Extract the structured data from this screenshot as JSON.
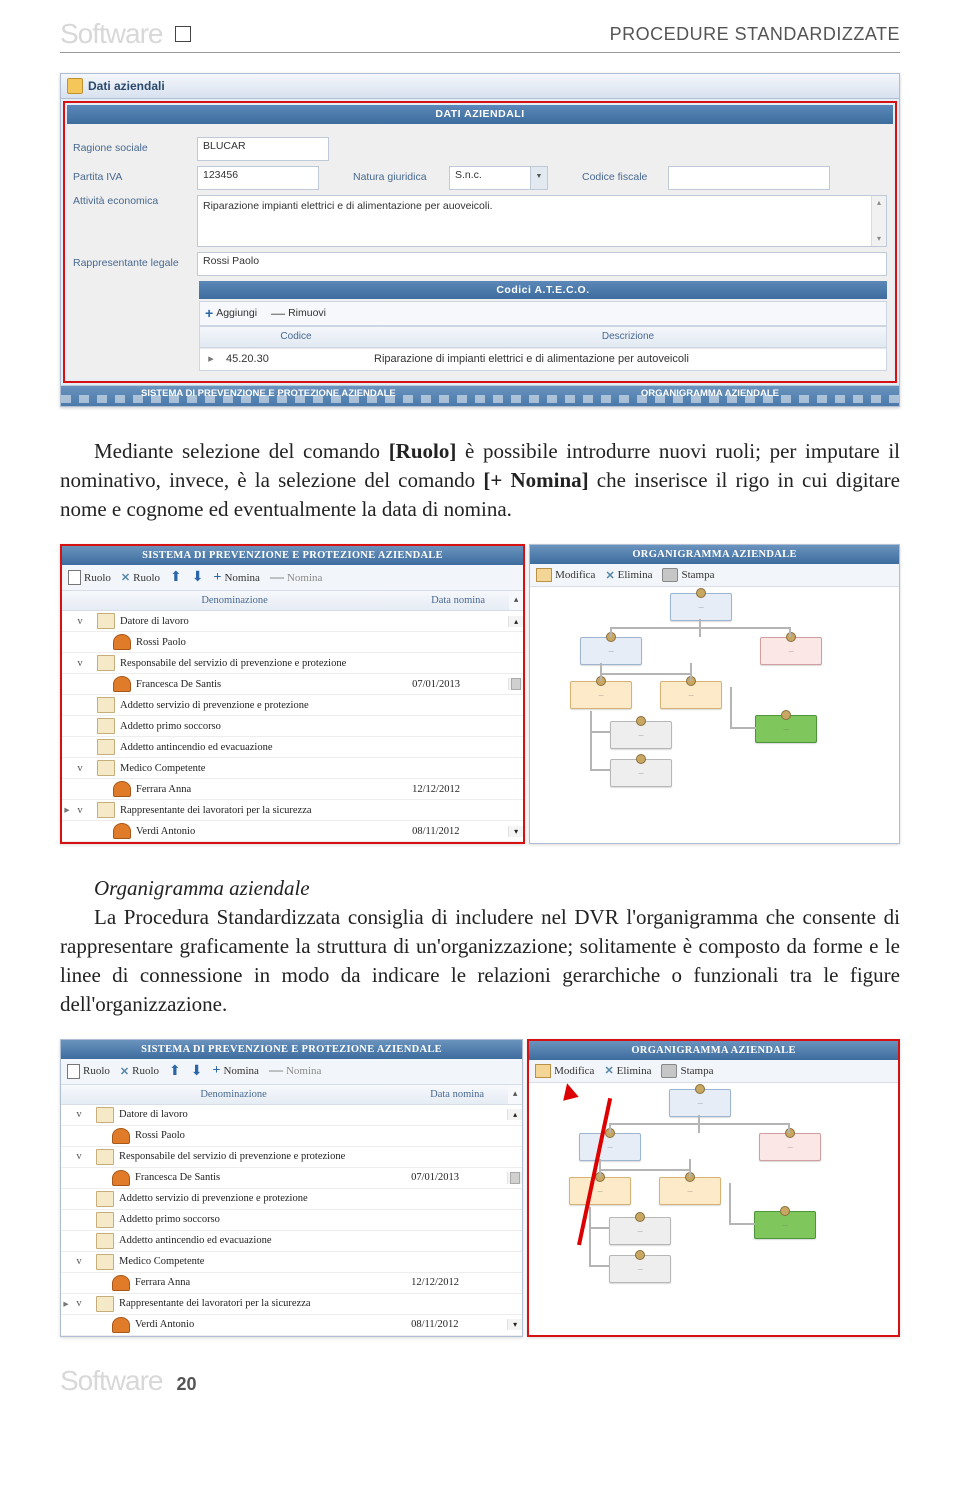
{
  "header": {
    "brand_a": "Software",
    "title": "PROCEDURE STANDARDIZZATE"
  },
  "paragraph1": {
    "line1": "Mediante selezione del comando ",
    "b1": "[Ruolo]",
    "line2": " è possibile introdurre nuovi ruoli; per imputare il nominativo, invece, è la selezione del comando ",
    "b2": "[+ Nomina]",
    "line3": " che inserisce il rigo in cui digitare nome e cognome ed eventualmente la data di nomina."
  },
  "section2": {
    "heading": "Organigramma aziendale",
    "text": "La Procedura Standardizzata consiglia di includere nel DVR l'organigramma che consente di rappresentare graficamente la struttura di un'organizzazione; solitamente è composto da forme e le linee di connessione in modo da indicare le relazioni gerarchiche o funzionali tra le figure dell'organizzazione."
  },
  "shot1": {
    "window_title": "Dati aziendali",
    "panel_title": "DATI AZIENDALI",
    "labels": {
      "ragione": "Ragione sociale",
      "piva": "Partita IVA",
      "natura": "Natura giuridica",
      "cf": "Codice fiscale",
      "attivita": "Attività economica",
      "rappr": "Rappresentante legale",
      "ateco_title": "Codici A.T.E.C.O.",
      "col_codice": "Codice",
      "col_descr": "Descrizione"
    },
    "values": {
      "ragione": "BLUCAR",
      "piva": "123456",
      "natura": "S.n.c.",
      "cf": "",
      "attivita": "Riparazione impianti elettrici e di alimentazione per auoveicoli.",
      "rappr": "Rossi Paolo",
      "codice": "45.20.30",
      "descr": "Riparazione di impianti elettrici e di alimentazione per autoveicoli",
      "add": "Aggiungi",
      "rem": "Rimuovi"
    },
    "strip_left": "SISTEMA DI PREVENZIONE E PROTEZIONE AZIENDALE",
    "strip_right": "ORGANIGRAMMA AZIENDALE"
  },
  "shot2": {
    "left_title": "SISTEMA DI PREVENZIONE E PROTEZIONE AZIENDALE",
    "right_title": "ORGANIGRAMMA AZIENDALE",
    "toolbar_left": {
      "ruolo": "Ruolo",
      "ruolo2": "Ruolo",
      "nomina": "Nomina",
      "nominag": "Nomina"
    },
    "toolbar_right": {
      "modifica": "Modifica",
      "elimina": "Elimina",
      "stampa": "Stampa"
    },
    "cols": {
      "c1": "Denominazione",
      "c2": "Data nomina"
    },
    "rows": [
      {
        "exp": "v",
        "type": "card",
        "label": "Datore di lavoro",
        "date": "",
        "indent": 0
      },
      {
        "exp": "",
        "type": "person",
        "label": "Rossi Paolo",
        "date": "",
        "indent": 1
      },
      {
        "exp": "v",
        "type": "card",
        "label": "Responsabile del servizio di prevenzione e protezione",
        "date": "",
        "indent": 0
      },
      {
        "exp": "",
        "type": "person",
        "label": "Francesca De Santis",
        "date": "07/01/2013",
        "indent": 1
      },
      {
        "exp": "",
        "type": "card",
        "label": "Addetto servizio di prevenzione e protezione",
        "date": "",
        "indent": 0
      },
      {
        "exp": "",
        "type": "card",
        "label": "Addetto primo soccorso",
        "date": "",
        "indent": 0
      },
      {
        "exp": "",
        "type": "card",
        "label": "Addetto antincendio ed evacuazione",
        "date": "",
        "indent": 0
      },
      {
        "exp": "v",
        "type": "card",
        "label": "Medico Competente",
        "date": "",
        "indent": 0
      },
      {
        "exp": "",
        "type": "person",
        "label": "Ferrara Anna",
        "date": "12/12/2012",
        "indent": 1
      },
      {
        "exp": "v",
        "type": "card",
        "label": "Rappresentante dei lavoratori per la sicurezza",
        "date": "",
        "indent": 0,
        "marker": true
      },
      {
        "exp": "",
        "type": "person",
        "label": "Verdi Antonio",
        "date": "08/11/2012",
        "indent": 1
      }
    ]
  },
  "page_number": "20"
}
